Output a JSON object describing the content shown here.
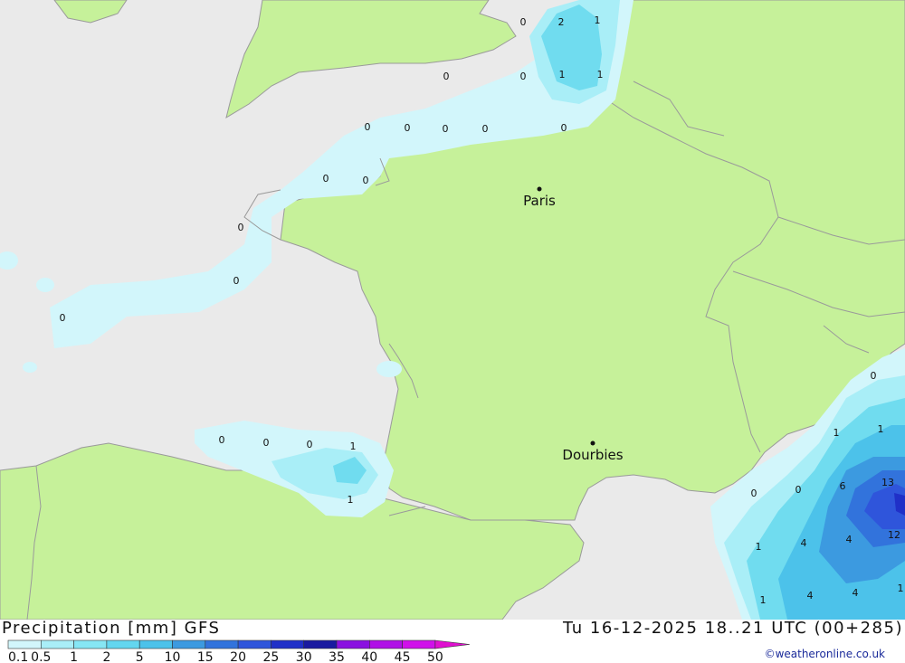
{
  "map": {
    "colors": {
      "sea": "#eaeaea",
      "land": "#c6f19a",
      "border": "#9a9a9a",
      "precip_light": "#d2f6fb",
      "precip_1": "#a9eef7",
      "precip_2": "#70dcef",
      "precip_5": "#4cc2ea",
      "precip_10": "#3c9ae0",
      "precip_15": "#2f55db",
      "precip_20": "#2030c8"
    },
    "cities": [
      {
        "name": "Paris"
      },
      {
        "name": "Dourbies"
      }
    ],
    "values": [
      "0",
      "2",
      "1",
      "0",
      "1",
      "1",
      "0",
      "0",
      "0",
      "0",
      "0",
      "0",
      "0",
      "0",
      "0",
      "0",
      "0",
      "0",
      "0",
      "0",
      "1",
      "1",
      "0",
      "1",
      "1",
      "0",
      "0",
      "6",
      "13",
      "1",
      "4",
      "4",
      "12",
      "1",
      "4",
      "4",
      "1"
    ]
  },
  "footer": {
    "title_left": "Precipitation [mm] GFS",
    "title_right": "Tu 16-12-2025 18..21 UTC (00+285)",
    "credit": "©weatheronline.co.uk"
  },
  "legend": {
    "labels": [
      "0.1",
      "0.5",
      "1",
      "2",
      "5",
      "10",
      "15",
      "20",
      "25",
      "30",
      "35",
      "40",
      "45",
      "50"
    ],
    "colors": [
      "#d2f6fb",
      "#a9eef7",
      "#86e6f4",
      "#63d6ef",
      "#4cc2ea",
      "#3c9ae0",
      "#3273dc",
      "#2f55db",
      "#2030c8",
      "#1a1aa0",
      "#8a10e0",
      "#b010e6",
      "#d010ea",
      "#e010d0",
      "#b0109a"
    ]
  }
}
